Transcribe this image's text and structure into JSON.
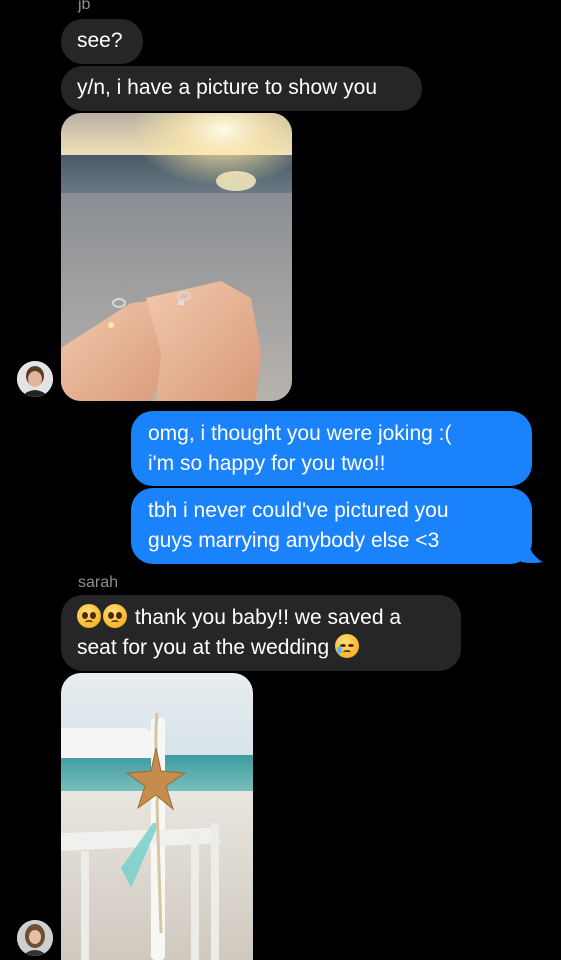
{
  "thread": {
    "first_sender": "jb",
    "second_sender": "sarah"
  },
  "messages": {
    "m1": "see?",
    "m2": "y/n, i have a picture to show you",
    "m3_line1": "omg, i thought you were joking :(",
    "m3_line2": "i'm so happy for you two!!",
    "m4_line1": "tbh i never could've pictured you",
    "m4_line2": "guys marrying anybody else <3",
    "m5_line1": "thank you baby!! we saved a",
    "m5_line2": "seat for you at the wedding"
  },
  "icons": {
    "pleading": "pleading-face-emoji",
    "crying": "crying-face-emoji"
  },
  "colors": {
    "background": "#000000",
    "incoming_bubble": "#262628",
    "outgoing_bubble": "#1a82fb",
    "sender_label": "#8e8e93"
  }
}
